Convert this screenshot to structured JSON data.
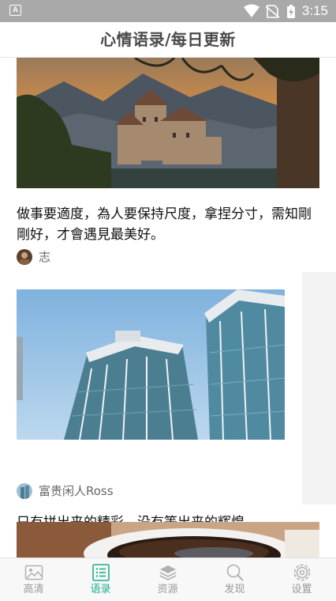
{
  "status_bar": {
    "badge": "A",
    "time": "3:15",
    "icons": [
      "wifi-icon",
      "no-sim-icon",
      "battery-charging-icon"
    ]
  },
  "header": {
    "title": "心情语录/每日更新"
  },
  "feed": {
    "cards": [
      {
        "image": "castle-by-lake-sunset-photo",
        "quote": "做事要適度，為人要保持尺度，拿捏分寸，需知剛剛好，才會遇見最美好。",
        "author": "志"
      },
      {
        "image": "high-rise-buildings-photo",
        "quote": "只有拼出来的精彩，没有等出来的辉煌。",
        "author": "富贵闲人Ross"
      },
      {
        "image": "coffee-cup-photo"
      }
    ]
  },
  "bottom_nav": {
    "active": "语录",
    "items": [
      {
        "label": "高清",
        "icon": "image-icon"
      },
      {
        "label": "语录",
        "icon": "list-icon"
      },
      {
        "label": "资源",
        "icon": "layers-icon"
      },
      {
        "label": "发现",
        "icon": "search-icon"
      },
      {
        "label": "设置",
        "icon": "gear-icon"
      }
    ]
  },
  "colors": {
    "accent": "#1fae8e",
    "status_bar": "#a9a9a9",
    "inactive": "#9a9a9a"
  }
}
